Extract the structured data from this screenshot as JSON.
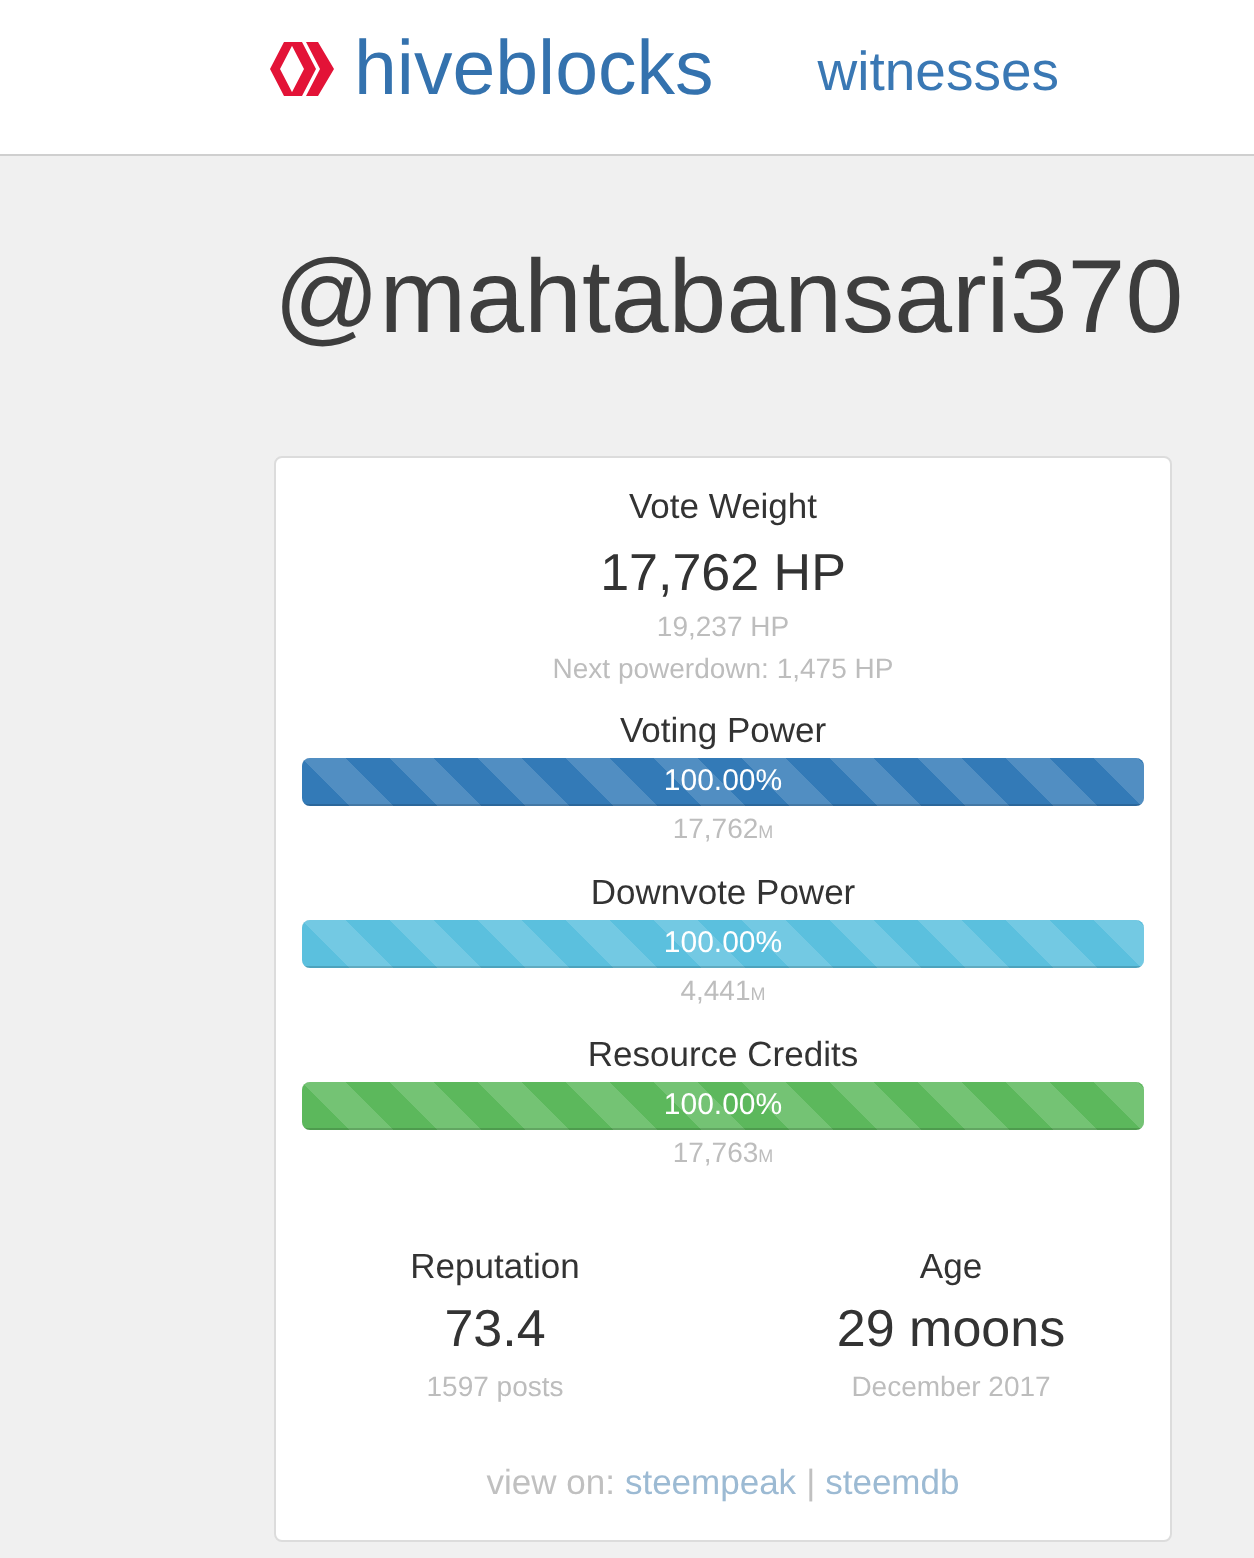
{
  "header": {
    "brand": "hiveblocks",
    "nav": [
      {
        "label": "witnesses"
      }
    ]
  },
  "username": "@mahtabansari370",
  "vote_weight": {
    "label": "Vote Weight",
    "value": "17,762 HP",
    "notes": [
      "19,237 HP",
      "Next powerdown: 1,475 HP"
    ]
  },
  "meters": [
    {
      "label": "Voting Power",
      "level": 1,
      "color": "#337ab7",
      "percent": "100.00%",
      "value": "17,762",
      "unit": "M"
    },
    {
      "label": "Downvote Power",
      "level": 1,
      "color": "#5bc0de",
      "percent": "100.00%",
      "value": "4,441",
      "unit": "M"
    },
    {
      "label": "Resource Credits",
      "level": 1,
      "color": "#5cb85c",
      "percent": "100.00%",
      "value": "17,763",
      "unit": "M"
    }
  ],
  "stats": [
    {
      "label": "Reputation",
      "value": "73.4",
      "note": "1597 posts"
    },
    {
      "label": "Age",
      "value": "29 moons",
      "note": "December 2017"
    }
  ],
  "view_on": {
    "label": "view on:",
    "links": [
      "steempeak",
      "steemdb"
    ],
    "separator": "|"
  }
}
